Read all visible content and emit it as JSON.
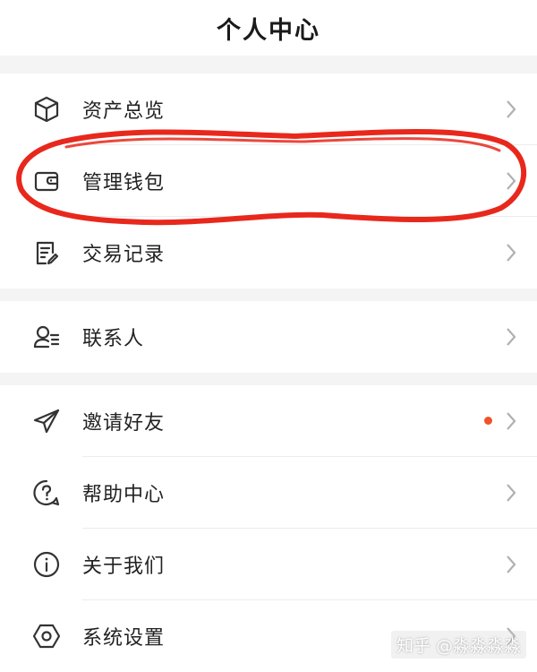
{
  "header": {
    "title": "个人中心"
  },
  "menu": {
    "assets": {
      "label": "资产总览",
      "icon": "cube-icon"
    },
    "wallet": {
      "label": "管理钱包",
      "icon": "wallet-icon"
    },
    "transactions": {
      "label": "交易记录",
      "icon": "document-edit-icon"
    },
    "contacts": {
      "label": "联系人",
      "icon": "contact-list-icon"
    },
    "invite": {
      "label": "邀请好友",
      "icon": "paper-plane-icon",
      "has_badge_dot": true
    },
    "help": {
      "label": "帮助中心",
      "icon": "question-bubble-icon"
    },
    "about": {
      "label": "关于我们",
      "icon": "info-circle-icon"
    },
    "settings": {
      "label": "系统设置",
      "icon": "hexagon-settings-icon"
    }
  },
  "annotation": {
    "type": "red hand-drawn ellipse",
    "target": "管理钱包",
    "color": "#e8281c"
  },
  "watermark": {
    "text": "知乎 @淼淼淼淼"
  },
  "colors": {
    "accent_dot": "#f0522a",
    "section_gap": "#f4f4f4",
    "chevron": "#b0b0b0"
  }
}
